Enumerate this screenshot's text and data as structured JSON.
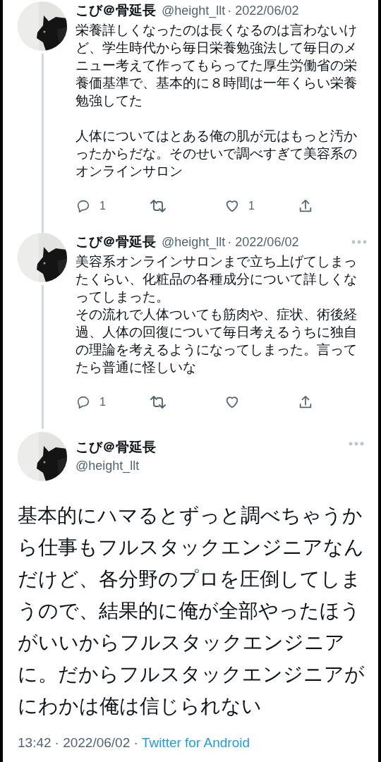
{
  "thread": [
    {
      "name": "こび＠骨延長",
      "handle": "@height_llt",
      "date": "· 2022/06/02",
      "paragraphs": [
        [
          "栄養詳しくなったのは長くなるのは言わないけど、学生時代から毎日栄養勉強法して毎日のメニュー考えて作ってもらってた厚生労働省の栄養価基準で、基本的に８時間は一年くらい栄養勉強してた"
        ],
        [
          "人体についてはとある俺の肌が元はもっと汚かったからだな。そのせいで調べすぎて美容系のオンラインサロン"
        ]
      ],
      "reply_count": "1",
      "like_count": "1",
      "more_menu": false
    },
    {
      "name": "こび＠骨延長",
      "handle": "@height_llt",
      "date": "· 2022/06/02",
      "paragraphs": [
        [
          "美容系オンラインサロンまで立ち上げてしまったくらい、化粧品の各種成分について詳しくなってしまった。",
          "その流れで人体ついても筋肉や、症状、術後経過、人体の回復について毎日考えるうちに独自の理論を考えるようになってしまった。言ってたら普通に怪しいな"
        ]
      ],
      "reply_count": "1",
      "more_menu": true
    }
  ],
  "main_tweet": {
    "name": "こび＠骨延長",
    "handle": "@height_llt",
    "text": "基本的にハマるとずっと調べちゃうから仕事もフルスタックエンジニアなんだけど、各分野のプロを圧倒してしまうので、結果的に俺が全部やったほうがいいからフルスタックエンジニアに。だからフルスタックエンジニアがにわかは俺は信じられない",
    "time": "13:42",
    "date": "· 2022/06/02 ·",
    "source": "Twitter for Android"
  }
}
